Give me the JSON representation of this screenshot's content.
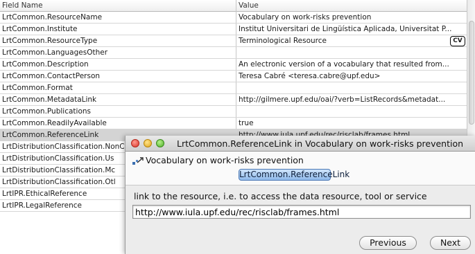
{
  "table": {
    "header": {
      "field": "Field Name",
      "value": "Value"
    },
    "rows": [
      {
        "field": "LrtCommon.ResourceName",
        "value": "Vocabulary on work-risks prevention"
      },
      {
        "field": "LrtCommon.Institute",
        "value": "Institut Universitari de Lingüística Aplicada, Universitat P..."
      },
      {
        "field": "LrtCommon.ResourceType",
        "value": "Terminological Resource",
        "badge": "CV"
      },
      {
        "field": "LrtCommon.LanguagesOther",
        "value": ""
      },
      {
        "field": "LrtCommon.Description",
        "value": "An electronic version of a vocabulary that resulted from..."
      },
      {
        "field": "LrtCommon.ContactPerson",
        "value": "Teresa Cabré <teresa.cabre@upf.edu>"
      },
      {
        "field": "LrtCommon.Format",
        "value": ""
      },
      {
        "field": "LrtCommon.MetadataLink",
        "value": "http://gilmere.upf.edu/oai/?verb=ListRecords&metadat..."
      },
      {
        "field": "LrtCommon.Publications",
        "value": ""
      },
      {
        "field": "LrtCommon.ReadilyAvailable",
        "value": "true"
      },
      {
        "field": "LrtCommon.ReferenceLink",
        "value": "http://www.iula.upf.edu/rec/risclab/frames.html",
        "selected": true
      },
      {
        "field": "LrtDistributionClassification.NonCommercialUsageOnly",
        "value": "false"
      },
      {
        "field": "LrtDistributionClassification.Us",
        "value": ""
      },
      {
        "field": "LrtDistributionClassification.Mc",
        "value": ""
      },
      {
        "field": "LrtDistributionClassification.Otl",
        "value": ""
      },
      {
        "field": "LrtIPR.EthicalReference",
        "value": ""
      },
      {
        "field": "LrtIPR.LegalReference",
        "value": ""
      }
    ]
  },
  "dialog": {
    "title": "LrtCommon.ReferenceLink in Vocabulary on work-risks prevention",
    "vocabulary": "Vocabulary on work-risks prevention",
    "field_label": "LrtCommon.ReferenceLink",
    "prompt": "link to the resource, i.e. to access the data resource, tool or service",
    "input_value": "http://www.iula.upf.edu/rec/risclab/frames.html",
    "previous_label": "Previous",
    "next_label": "Next",
    "icons": {
      "close": "close-traffic-light-icon",
      "minimize": "minimize-traffic-light-icon",
      "zoom": "zoom-traffic-light-icon",
      "wizard": "wizard-arrow-icon"
    }
  },
  "colors": {
    "selected_row": "#d4d4d4",
    "field_pill": "#8fb9ea",
    "close": "#d9352a",
    "minimize": "#e0a51b",
    "zoom": "#4fae2b"
  }
}
